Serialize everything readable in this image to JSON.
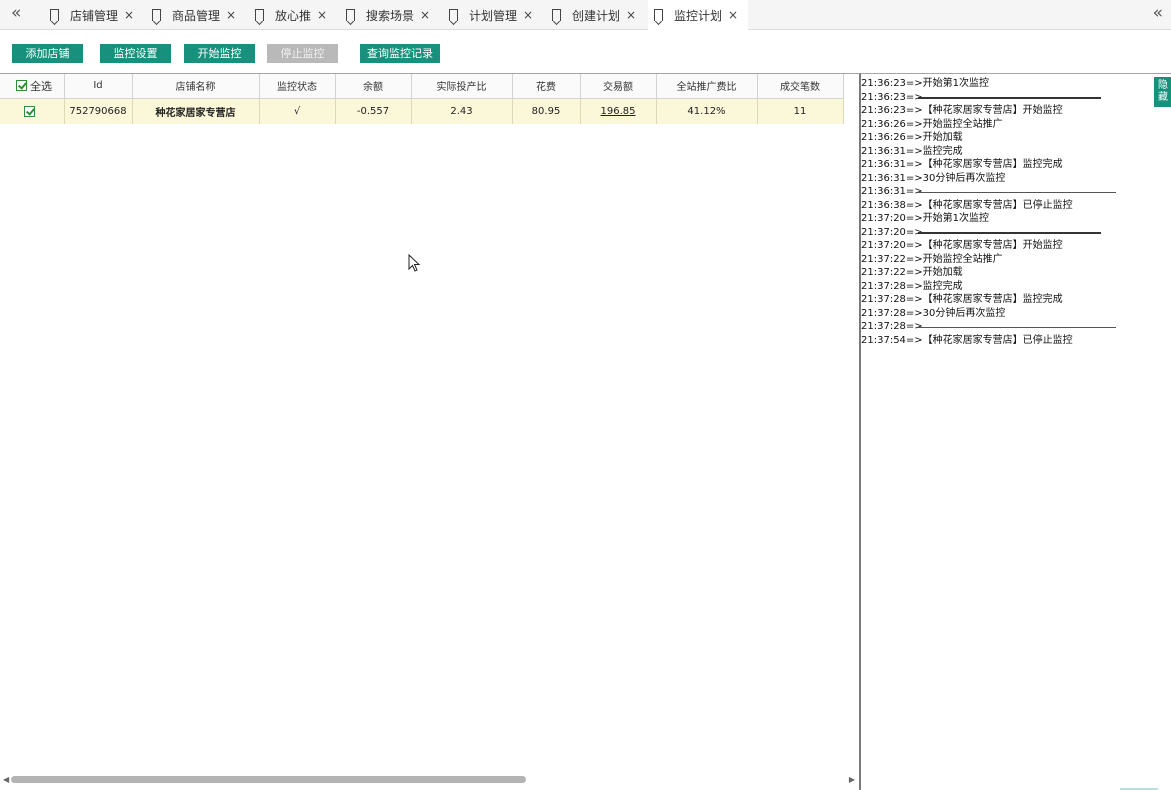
{
  "tabbar": {
    "prev_icon": "«",
    "next_icon": "«",
    "tabs": [
      {
        "label": "店铺管理",
        "active": false
      },
      {
        "label": "商品管理",
        "active": false
      },
      {
        "label": "放心推",
        "active": false
      },
      {
        "label": "搜索场景",
        "active": false
      },
      {
        "label": "计划管理",
        "active": false
      },
      {
        "label": "创建计划",
        "active": false
      },
      {
        "label": "监控计划",
        "active": true
      }
    ],
    "close_icon": "×"
  },
  "toolbar": {
    "add_shop": "添加店铺",
    "monitor_settings": "监控设置",
    "start_monitor": "开始监控",
    "stop_monitor": "停止监控",
    "query_records": "查询监控记录"
  },
  "table": {
    "select_all": "全选",
    "columns": [
      "Id",
      "店铺名称",
      "监控状态",
      "余额",
      "实际投产比",
      "花费",
      "交易额",
      "全站推广费比",
      "成交笔数"
    ],
    "rows": [
      {
        "checked": true,
        "id": "752790668",
        "shop_name": "种花家居家专营店",
        "status": "√",
        "balance": "-0.557",
        "roi": "2.43",
        "cost": "80.95",
        "gmv": "196.85",
        "fee_ratio": "41.12%",
        "orders": "11"
      }
    ]
  },
  "log": {
    "hide_button": "隐藏",
    "lines": [
      {
        "text": "21:36:23=>开始第1次监控"
      },
      {
        "text": "21:36:23=>"
      },
      {
        "text": "21:36:23=>【种花家居家专营店】开始监控"
      },
      {
        "text": "21:36:26=>开始监控全站推广"
      },
      {
        "text": "21:36:26=>开始加载"
      },
      {
        "text": "21:36:31=>监控完成"
      },
      {
        "text": "21:36:31=>【种花家居家专营店】监控完成"
      },
      {
        "text": "21:36:31=>30分钟后再次监控"
      },
      {
        "text": "21:36:31=>"
      },
      {
        "text": "21:36:38=>【种花家居家专营店】已停止监控"
      },
      {
        "text": "21:37:20=>开始第1次监控"
      },
      {
        "text": "21:37:20=>"
      },
      {
        "text": "21:37:20=>【种花家居家专营店】开始监控"
      },
      {
        "text": "21:37:22=>开始监控全站推广"
      },
      {
        "text": "21:37:22=>开始加载"
      },
      {
        "text": "21:37:28=>监控完成"
      },
      {
        "text": "21:37:28=>【种花家居家专营店】监控完成"
      },
      {
        "text": "21:37:28=>30分钟后再次监控"
      },
      {
        "text": "21:37:28=>"
      },
      {
        "text": "21:37:54=>【种花家居家专营店】已停止监控"
      }
    ]
  },
  "icons": {
    "bookmark": "bookmark-icon",
    "close": "close-icon",
    "nav": "double-chevron-left-icon",
    "checkbox": "checkbox-checked-icon",
    "cursor": "mouse-pointer-icon"
  },
  "colors": {
    "accent": "#17917c",
    "disabled": "#b9b9b9",
    "row_highlight": "#fbf7d9"
  }
}
